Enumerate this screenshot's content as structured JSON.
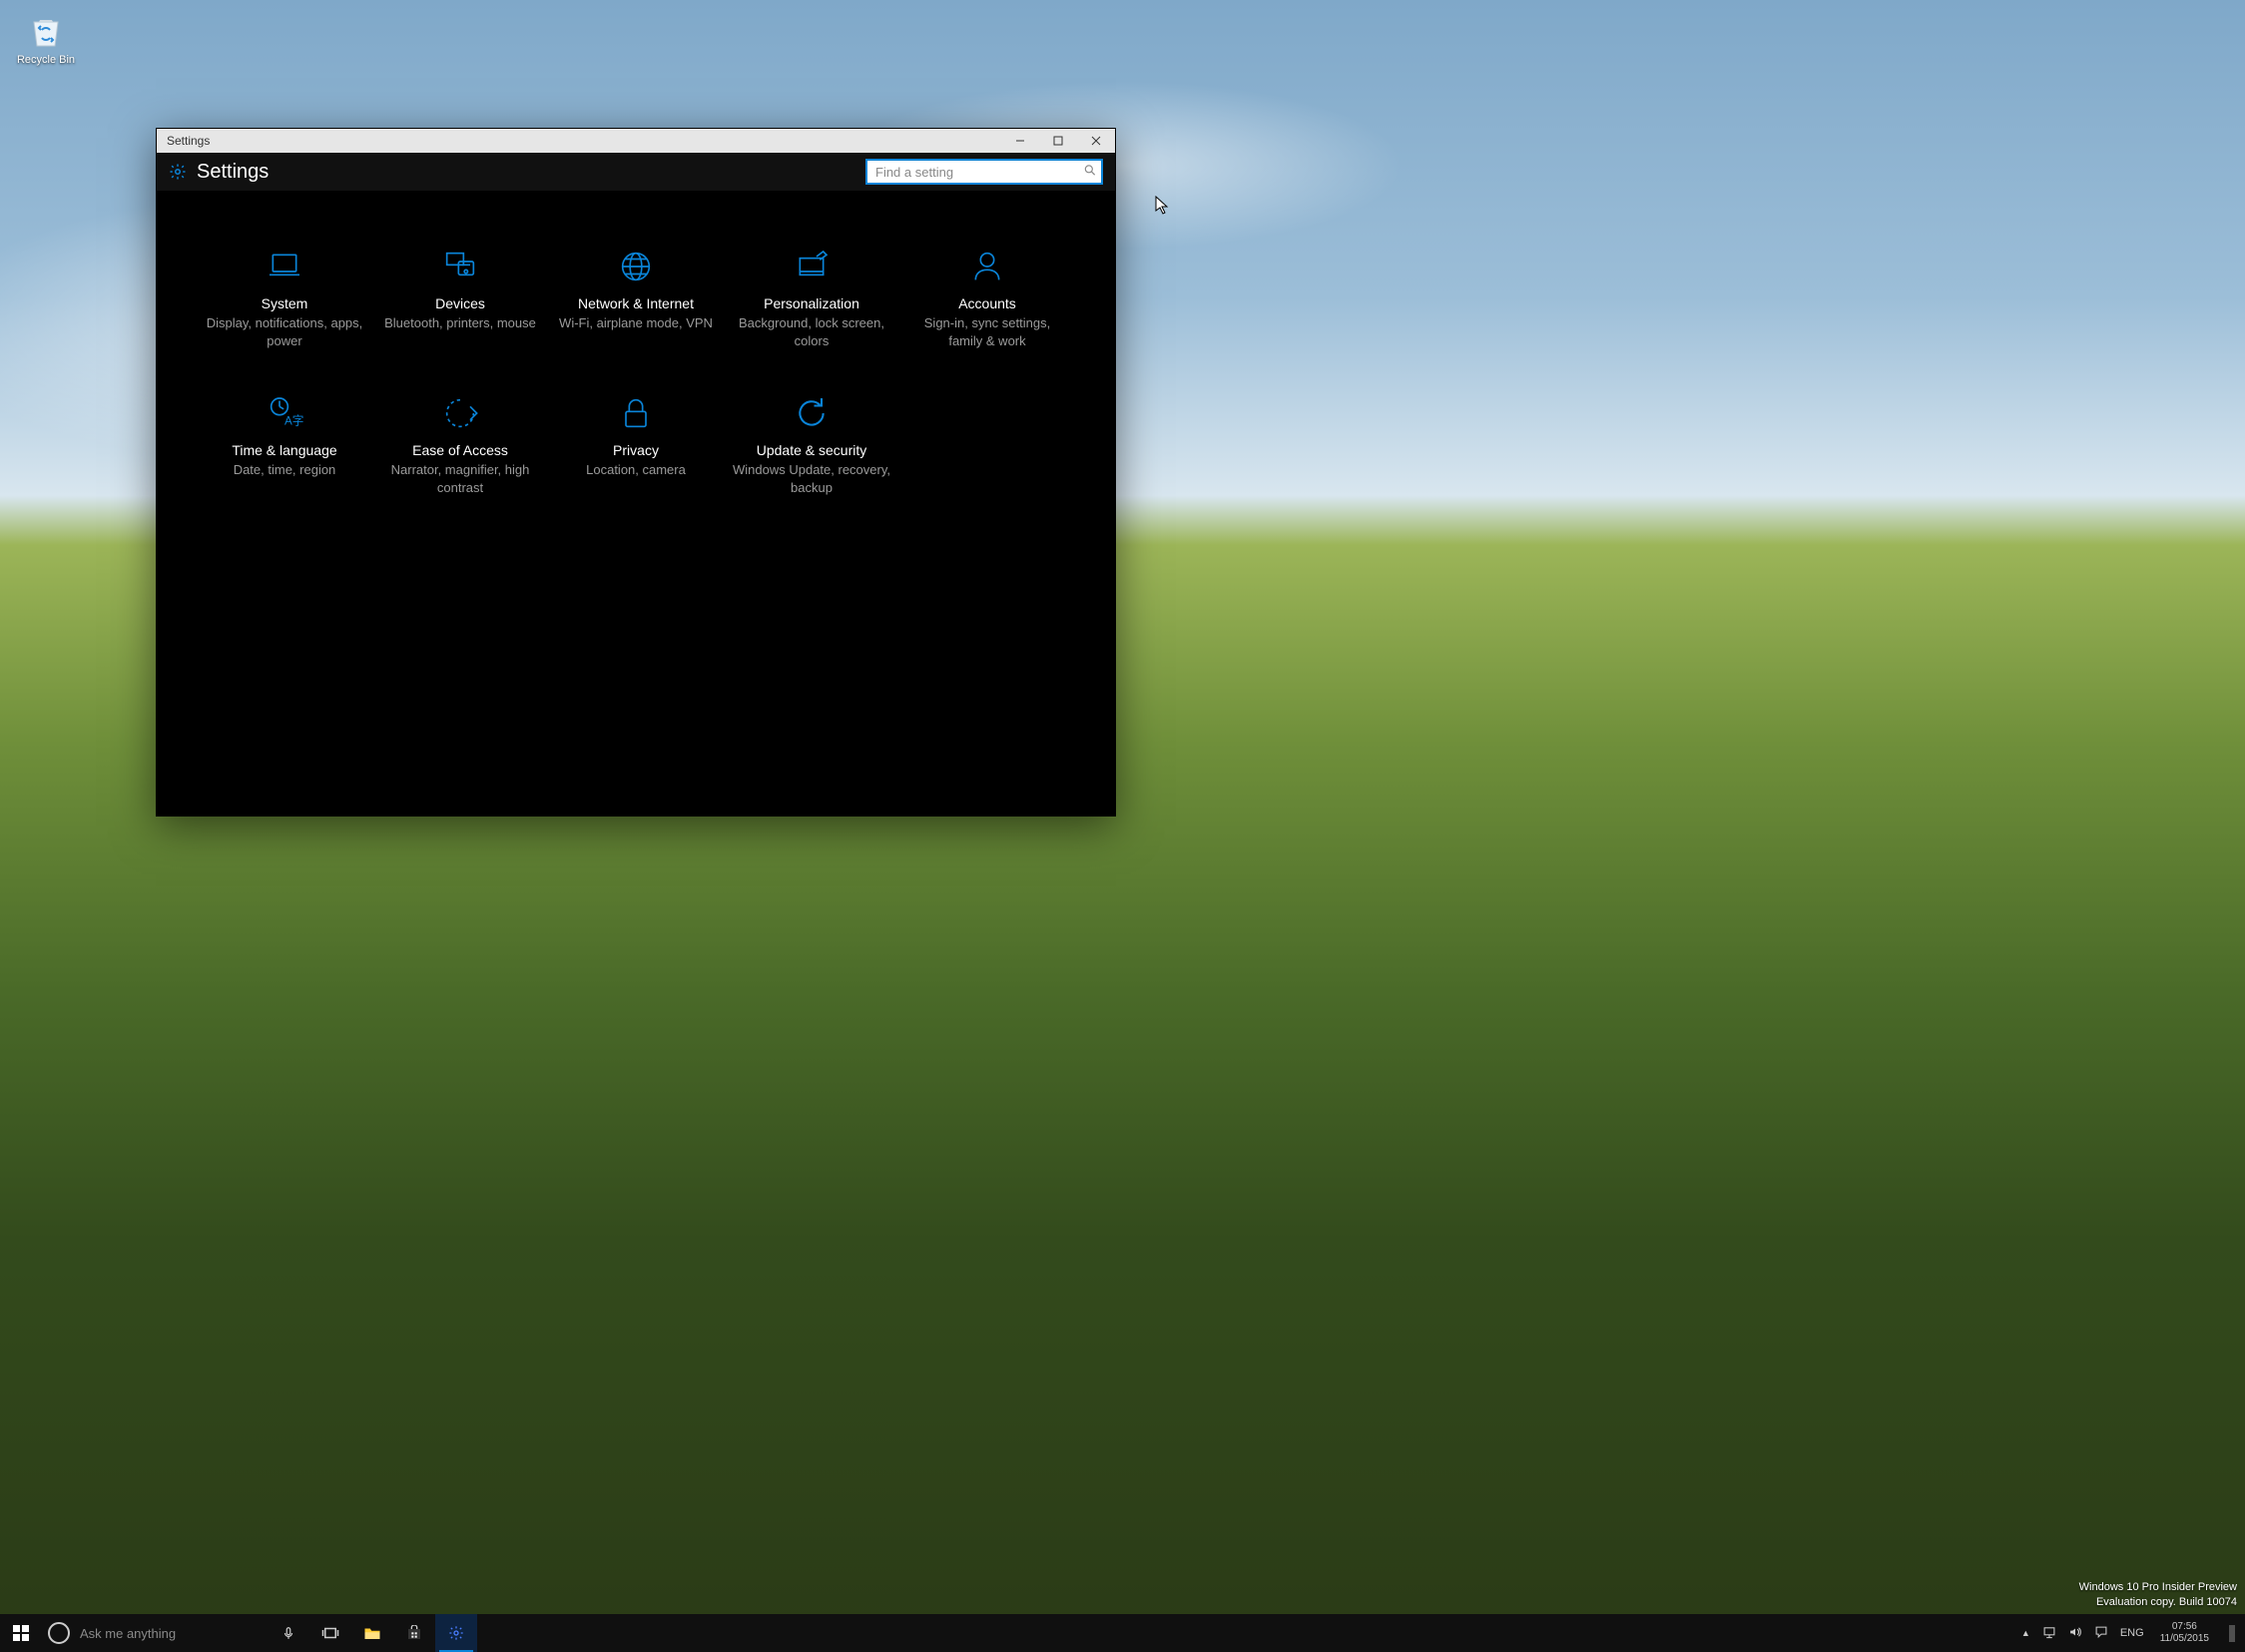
{
  "colors": {
    "accent": "#0a84d8"
  },
  "desktop_icons": [
    {
      "name": "recycle-bin",
      "label": "Recycle Bin"
    }
  ],
  "window": {
    "titlebar": "Settings",
    "header_title": "Settings",
    "search_placeholder": "Find a setting"
  },
  "categories": [
    {
      "icon": "laptop-icon",
      "title": "System",
      "desc": "Display, notifications, apps, power"
    },
    {
      "icon": "devices-icon",
      "title": "Devices",
      "desc": "Bluetooth, printers, mouse"
    },
    {
      "icon": "globe-icon",
      "title": "Network & Internet",
      "desc": "Wi-Fi, airplane mode, VPN"
    },
    {
      "icon": "personalization-icon",
      "title": "Personalization",
      "desc": "Background, lock screen, colors"
    },
    {
      "icon": "accounts-icon",
      "title": "Accounts",
      "desc": "Sign-in, sync settings, family & work"
    },
    {
      "icon": "time-language-icon",
      "title": "Time & language",
      "desc": "Date, time, region"
    },
    {
      "icon": "ease-of-access-icon",
      "title": "Ease of Access",
      "desc": "Narrator, magnifier, high contrast"
    },
    {
      "icon": "privacy-icon",
      "title": "Privacy",
      "desc": "Location, camera"
    },
    {
      "icon": "update-security-icon",
      "title": "Update & security",
      "desc": "Windows Update, recovery, backup"
    }
  ],
  "watermark": {
    "line1": "Windows 10 Pro Insider Preview",
    "line2": "Evaluation copy. Build 10074"
  },
  "taskbar": {
    "search_placeholder": "Ask me anything",
    "language": "ENG",
    "clock_time": "07:56",
    "clock_date": "11/05/2015"
  }
}
